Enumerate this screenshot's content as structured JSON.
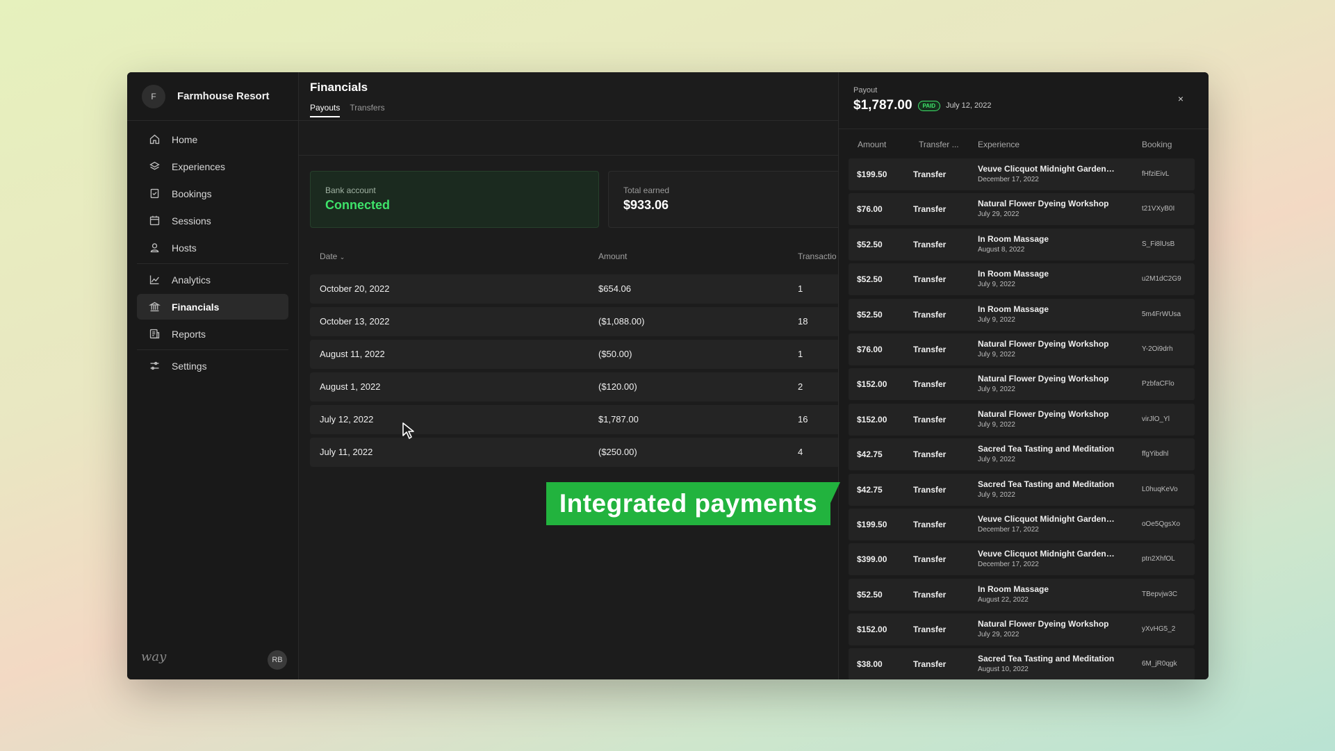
{
  "sidebar": {
    "org_initial": "F",
    "org_name": "Farmhouse Resort",
    "items": [
      {
        "label": "Home",
        "icon": "home-icon"
      },
      {
        "label": "Experiences",
        "icon": "layers-icon"
      },
      {
        "label": "Bookings",
        "icon": "bookings-icon"
      },
      {
        "label": "Sessions",
        "icon": "calendar-icon"
      },
      {
        "label": "Hosts",
        "icon": "user-icon"
      },
      {
        "label": "Analytics",
        "icon": "chart-icon"
      },
      {
        "label": "Financials",
        "icon": "bank-icon"
      },
      {
        "label": "Reports",
        "icon": "report-icon"
      },
      {
        "label": "Settings",
        "icon": "sliders-icon"
      }
    ],
    "brand": "way",
    "user_initials": "RB"
  },
  "main": {
    "title": "Financials",
    "tabs": [
      "Payouts",
      "Transfers"
    ],
    "bank_card": {
      "label": "Bank account",
      "value": "Connected"
    },
    "earned_card": {
      "label": "Total earned",
      "value": "$933.06"
    },
    "columns": [
      "Date",
      "Amount",
      "Transactio"
    ],
    "rows": [
      {
        "date": "October 20, 2022",
        "amount": "$654.06",
        "tx": "1"
      },
      {
        "date": "October 13, 2022",
        "amount": "($1,088.00)",
        "tx": "18"
      },
      {
        "date": "August 11, 2022",
        "amount": "($50.00)",
        "tx": "1"
      },
      {
        "date": "August 1, 2022",
        "amount": "($120.00)",
        "tx": "2"
      },
      {
        "date": "July 12, 2022",
        "amount": "$1,787.00",
        "tx": "16"
      },
      {
        "date": "July 11, 2022",
        "amount": "($250.00)",
        "tx": "4"
      }
    ]
  },
  "banner": {
    "text": "Integrated payments",
    "color": "#22b33e"
  },
  "drawer": {
    "label": "Payout",
    "amount": "$1,787.00",
    "badge": "PAID",
    "date": "July 12, 2022",
    "close": "×",
    "columns": [
      "Amount",
      "Transfer ...",
      "Experience",
      "Booking"
    ],
    "rows": [
      {
        "amount": "$199.50",
        "type": "Transfer",
        "experience": "Veuve Clicquot Midnight Garden | ...",
        "date": "December 17, 2022",
        "booking": "fHfziEivL"
      },
      {
        "amount": "$76.00",
        "type": "Transfer",
        "experience": "Natural Flower Dyeing Workshop",
        "date": "July 29, 2022",
        "booking": "t21VXyB0I"
      },
      {
        "amount": "$52.50",
        "type": "Transfer",
        "experience": "In Room Massage",
        "date": "August 8, 2022",
        "booking": "S_Fi8lUsB"
      },
      {
        "amount": "$52.50",
        "type": "Transfer",
        "experience": "In Room Massage",
        "date": "July 9, 2022",
        "booking": "u2M1dC2G9"
      },
      {
        "amount": "$52.50",
        "type": "Transfer",
        "experience": "In Room Massage",
        "date": "July 9, 2022",
        "booking": "5m4FrWUsa"
      },
      {
        "amount": "$76.00",
        "type": "Transfer",
        "experience": "Natural Flower Dyeing Workshop",
        "date": "July 9, 2022",
        "booking": "Y-2Oi9drh"
      },
      {
        "amount": "$152.00",
        "type": "Transfer",
        "experience": "Natural Flower Dyeing Workshop",
        "date": "July 9, 2022",
        "booking": "PzbfaCFlo"
      },
      {
        "amount": "$152.00",
        "type": "Transfer",
        "experience": "Natural Flower Dyeing Workshop",
        "date": "July 9, 2022",
        "booking": "virJlO_Yl"
      },
      {
        "amount": "$42.75",
        "type": "Transfer",
        "experience": "Sacred Tea Tasting and Meditation",
        "date": "July 9, 2022",
        "booking": "ffgYibdhl"
      },
      {
        "amount": "$42.75",
        "type": "Transfer",
        "experience": "Sacred Tea Tasting and Meditation",
        "date": "July 9, 2022",
        "booking": "L0huqKeVo"
      },
      {
        "amount": "$199.50",
        "type": "Transfer",
        "experience": "Veuve Clicquot Midnight Garden | ...",
        "date": "December 17, 2022",
        "booking": "oOe5QgsXo"
      },
      {
        "amount": "$399.00",
        "type": "Transfer",
        "experience": "Veuve Clicquot Midnight Garden | ...",
        "date": "December 17, 2022",
        "booking": "ptn2XhfOL"
      },
      {
        "amount": "$52.50",
        "type": "Transfer",
        "experience": "In Room Massage",
        "date": "August 22, 2022",
        "booking": "TBepvjw3C"
      },
      {
        "amount": "$152.00",
        "type": "Transfer",
        "experience": "Natural Flower Dyeing Workshop",
        "date": "July 29, 2022",
        "booking": "yXvHG5_2"
      },
      {
        "amount": "$38.00",
        "type": "Transfer",
        "experience": "Sacred Tea Tasting and Meditation",
        "date": "August 10, 2022",
        "booking": "6M_jR0qgk"
      }
    ]
  }
}
